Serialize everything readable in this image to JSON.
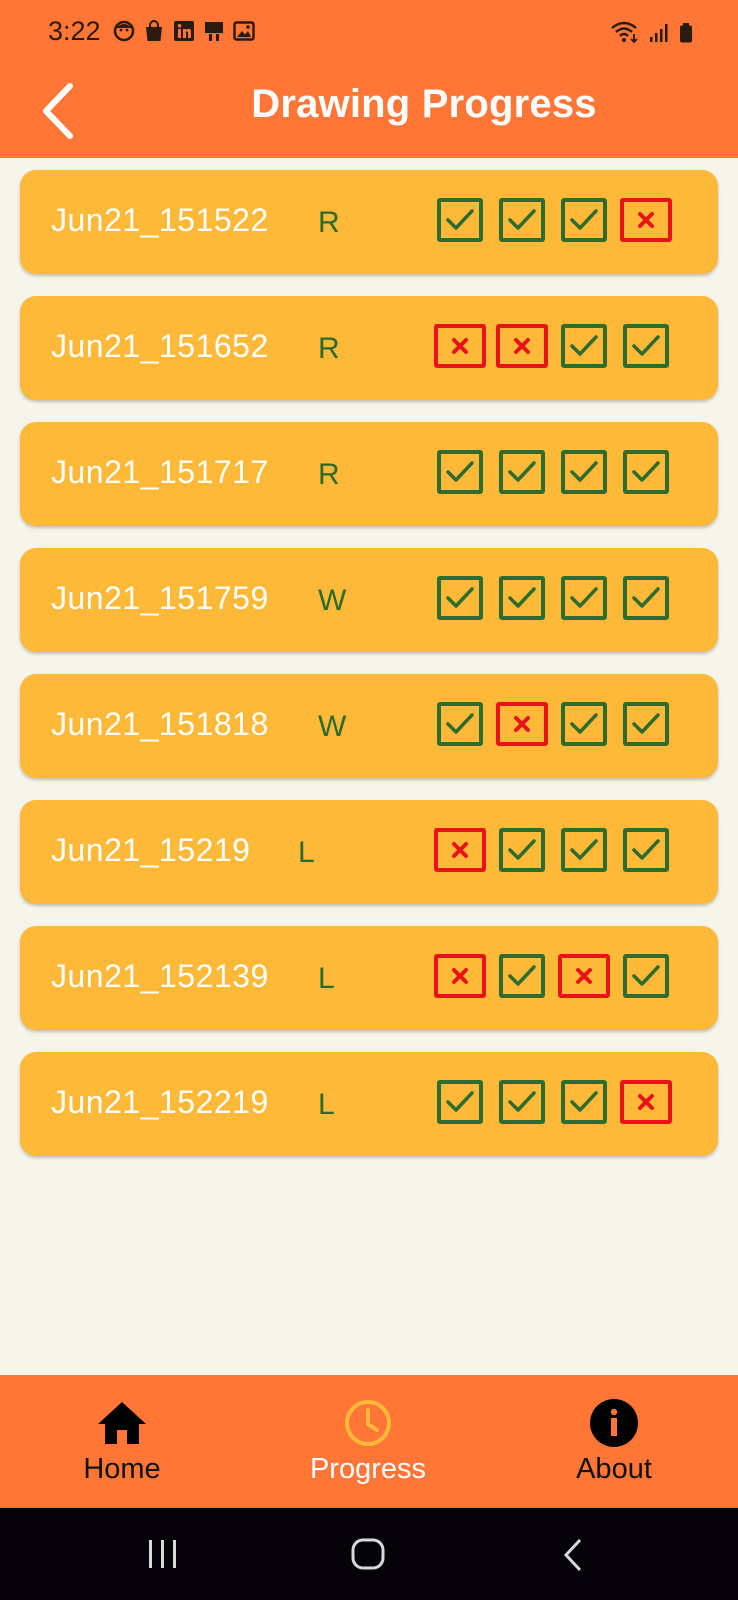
{
  "status_bar": {
    "time": "3:22",
    "left_icons": [
      "face-icon",
      "shopping-bag-icon",
      "linkedin-icon",
      "cast-icon",
      "image-icon"
    ],
    "right_icons": [
      "wifi-icon",
      "signal-icon",
      "battery-icon"
    ]
  },
  "header": {
    "back_icon": "chevron-left-icon",
    "title": "Drawing Progress"
  },
  "colors": {
    "primary": "#ff7637",
    "card": "#ffb938",
    "background": "#f6f5e9",
    "check_green": "#2e6b2f",
    "fail_red": "#e8131a",
    "active_tab": "#ffb938"
  },
  "entries": [
    {
      "name": "Jun21_151522",
      "side": "R",
      "results": [
        true,
        true,
        true,
        false
      ]
    },
    {
      "name": "Jun21_151652",
      "side": "R",
      "results": [
        false,
        false,
        true,
        true
      ]
    },
    {
      "name": "Jun21_151717",
      "side": "R",
      "results": [
        true,
        true,
        true,
        true
      ]
    },
    {
      "name": "Jun21_151759",
      "side": "W",
      "results": [
        true,
        true,
        true,
        true
      ]
    },
    {
      "name": "Jun21_151818",
      "side": "W",
      "results": [
        true,
        false,
        true,
        true
      ]
    },
    {
      "name": "Jun21_15219",
      "side": "L",
      "results": [
        false,
        true,
        true,
        true
      ]
    },
    {
      "name": "Jun21_152139",
      "side": "L",
      "results": [
        false,
        true,
        false,
        true
      ]
    },
    {
      "name": "Jun21_152219",
      "side": "L",
      "results": [
        true,
        true,
        true,
        false
      ]
    }
  ],
  "bottom_nav": {
    "items": [
      {
        "label": "Home",
        "icon": "home-icon",
        "active": false
      },
      {
        "label": "Progress",
        "icon": "clock-icon",
        "active": true
      },
      {
        "label": "About",
        "icon": "info-icon",
        "active": false
      }
    ]
  },
  "system_nav": {
    "icons": [
      "recents-icon",
      "home-circle-icon",
      "back-icon"
    ]
  }
}
